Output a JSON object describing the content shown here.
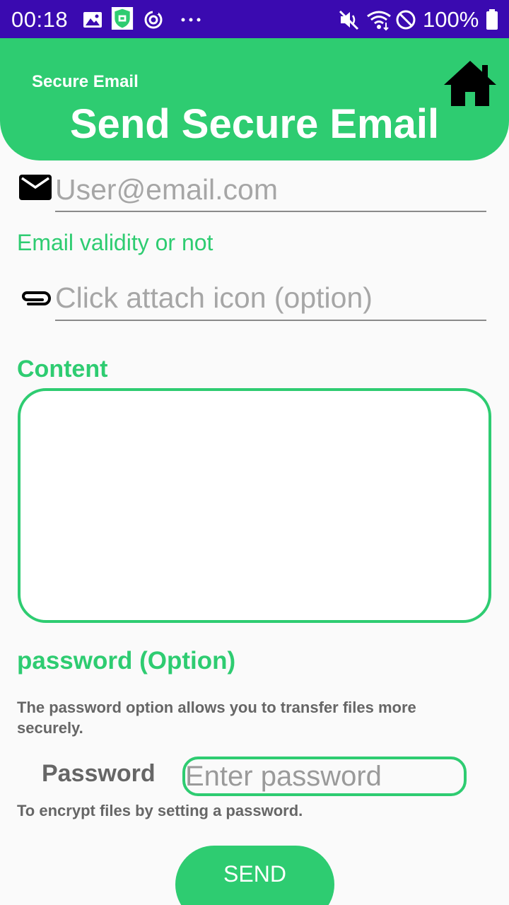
{
  "status_bar": {
    "time": "00:18",
    "battery": "100%",
    "icons": [
      "gallery-icon",
      "app-shield-icon",
      "sync-icon",
      "more-dots-icon",
      "mute-icon",
      "wifi-icon",
      "do-not-disturb-icon",
      "battery-icon"
    ],
    "background": "#3a0ab0"
  },
  "header": {
    "small_title": "Secure Email",
    "title": "Send Secure Email",
    "home_icon": "home-icon",
    "accent": "#2ecc71"
  },
  "email": {
    "icon": "mail-icon",
    "placeholder": "User@email.com",
    "value": "",
    "validity_text": "Email validity or not"
  },
  "attachment": {
    "icon": "paperclip-icon",
    "placeholder": "Click attach icon (option)",
    "value": ""
  },
  "content": {
    "label": "Content",
    "value": ""
  },
  "password": {
    "heading": "password (Option)",
    "description": "The password option allows you to transfer files more securely.",
    "label": "Password",
    "placeholder": "Enter password",
    "hint": "To encrypt files by setting a password."
  },
  "send_button": {
    "label": "SEND"
  }
}
